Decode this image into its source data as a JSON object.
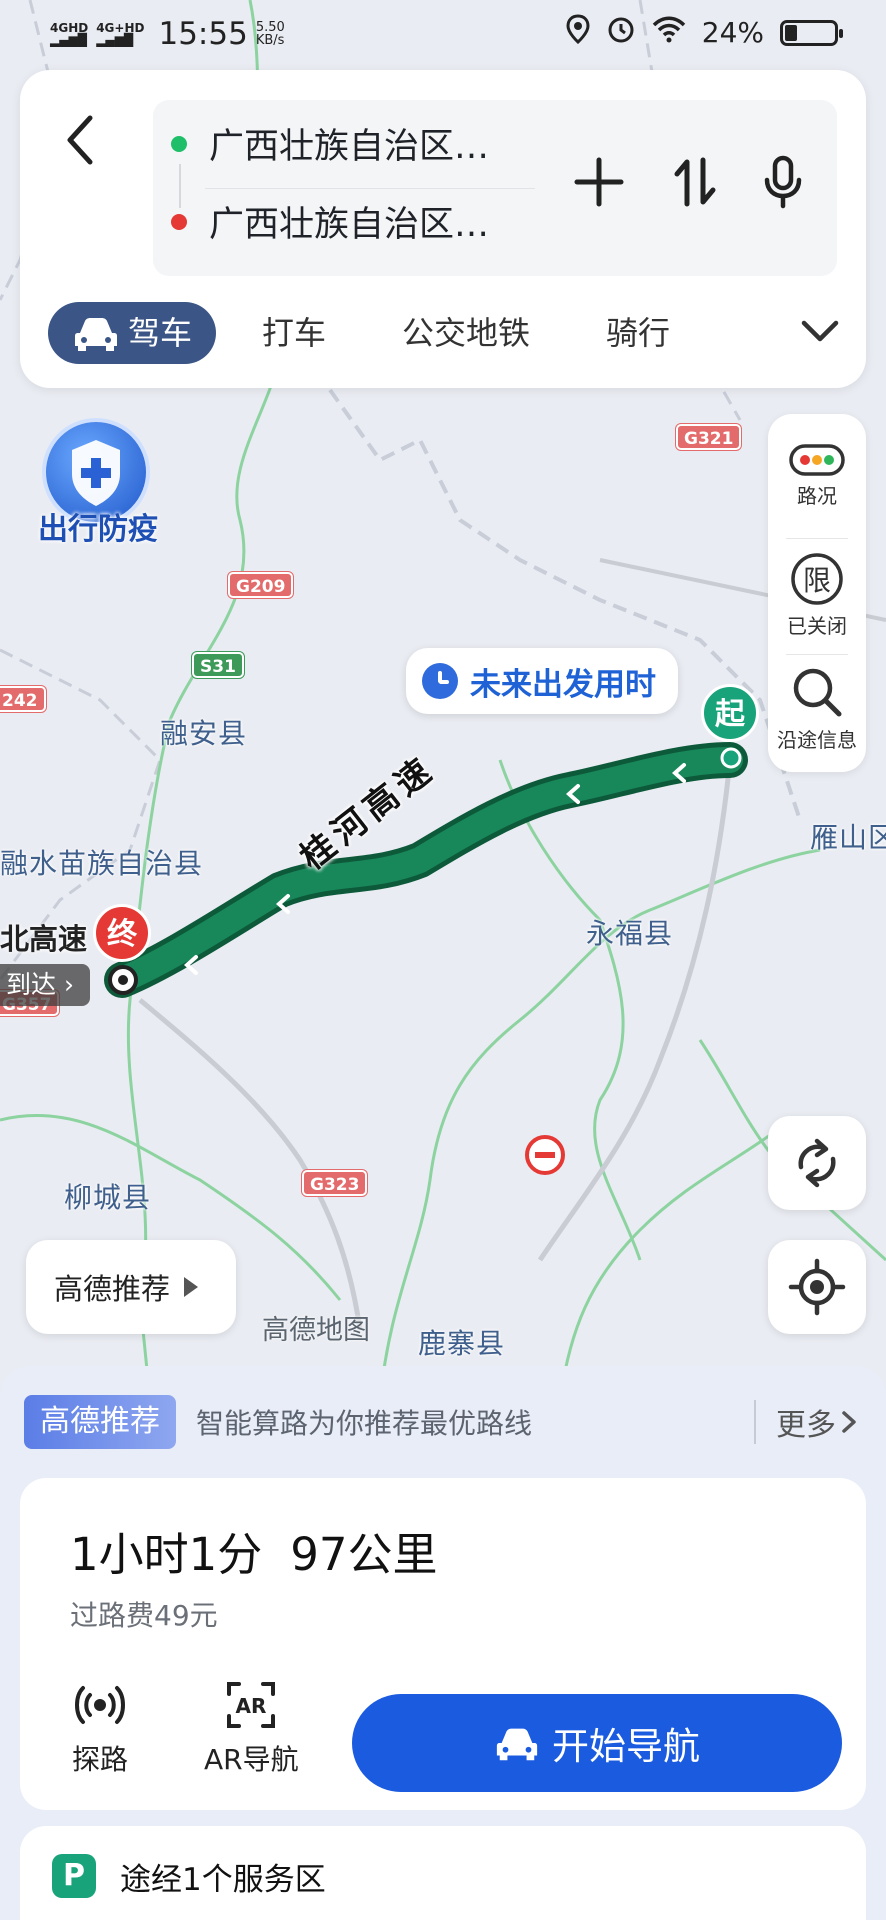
{
  "status_bar": {
    "network1": "4GHD",
    "network2": "4G+HD",
    "time": "15:55",
    "speed": "5.50 KB/s",
    "battery": "24%",
    "battery_level": 0.24
  },
  "route_inputs": {
    "start": "广西壮族自治区…",
    "end": "广西壮族自治区…"
  },
  "modes": [
    {
      "label": "驾车",
      "active": true
    },
    {
      "label": "打车",
      "active": false
    },
    {
      "label": "公交地铁",
      "active": false
    },
    {
      "label": "骑行",
      "active": false
    }
  ],
  "side_panel": {
    "traffic": "路况",
    "restriction": "已关闭",
    "restriction_glyph": "限",
    "along_route": "沿途信息"
  },
  "map": {
    "epidemic_label": "出行防疫",
    "depart_time_label": "未来出发用时",
    "start_pin": "起",
    "end_pin": "终",
    "route_road": "桂河高速",
    "road_left": "北高速",
    "arrive_label": "到达",
    "watermark": "高德地图",
    "places": [
      {
        "name": "融安县"
      },
      {
        "name": "融水苗族自治县"
      },
      {
        "name": "永福县"
      },
      {
        "name": "柳城县"
      },
      {
        "name": "鹿寨县"
      },
      {
        "name": "雁山区"
      }
    ],
    "shields": [
      "G321",
      "G209",
      "S31",
      "242",
      "G323",
      "G357"
    ]
  },
  "recommend_chip": "高德推荐",
  "recommend_bar": {
    "tag": "高德推荐",
    "desc": "智能算路为你推荐最优路线",
    "more": "更多"
  },
  "route": {
    "duration": "1小时1分",
    "distance": "97公里",
    "toll": "过路费49元",
    "explore_label": "探路",
    "ar_label": "AR导航",
    "start_nav": "开始导航"
  },
  "service_area": "途经1个服务区"
}
